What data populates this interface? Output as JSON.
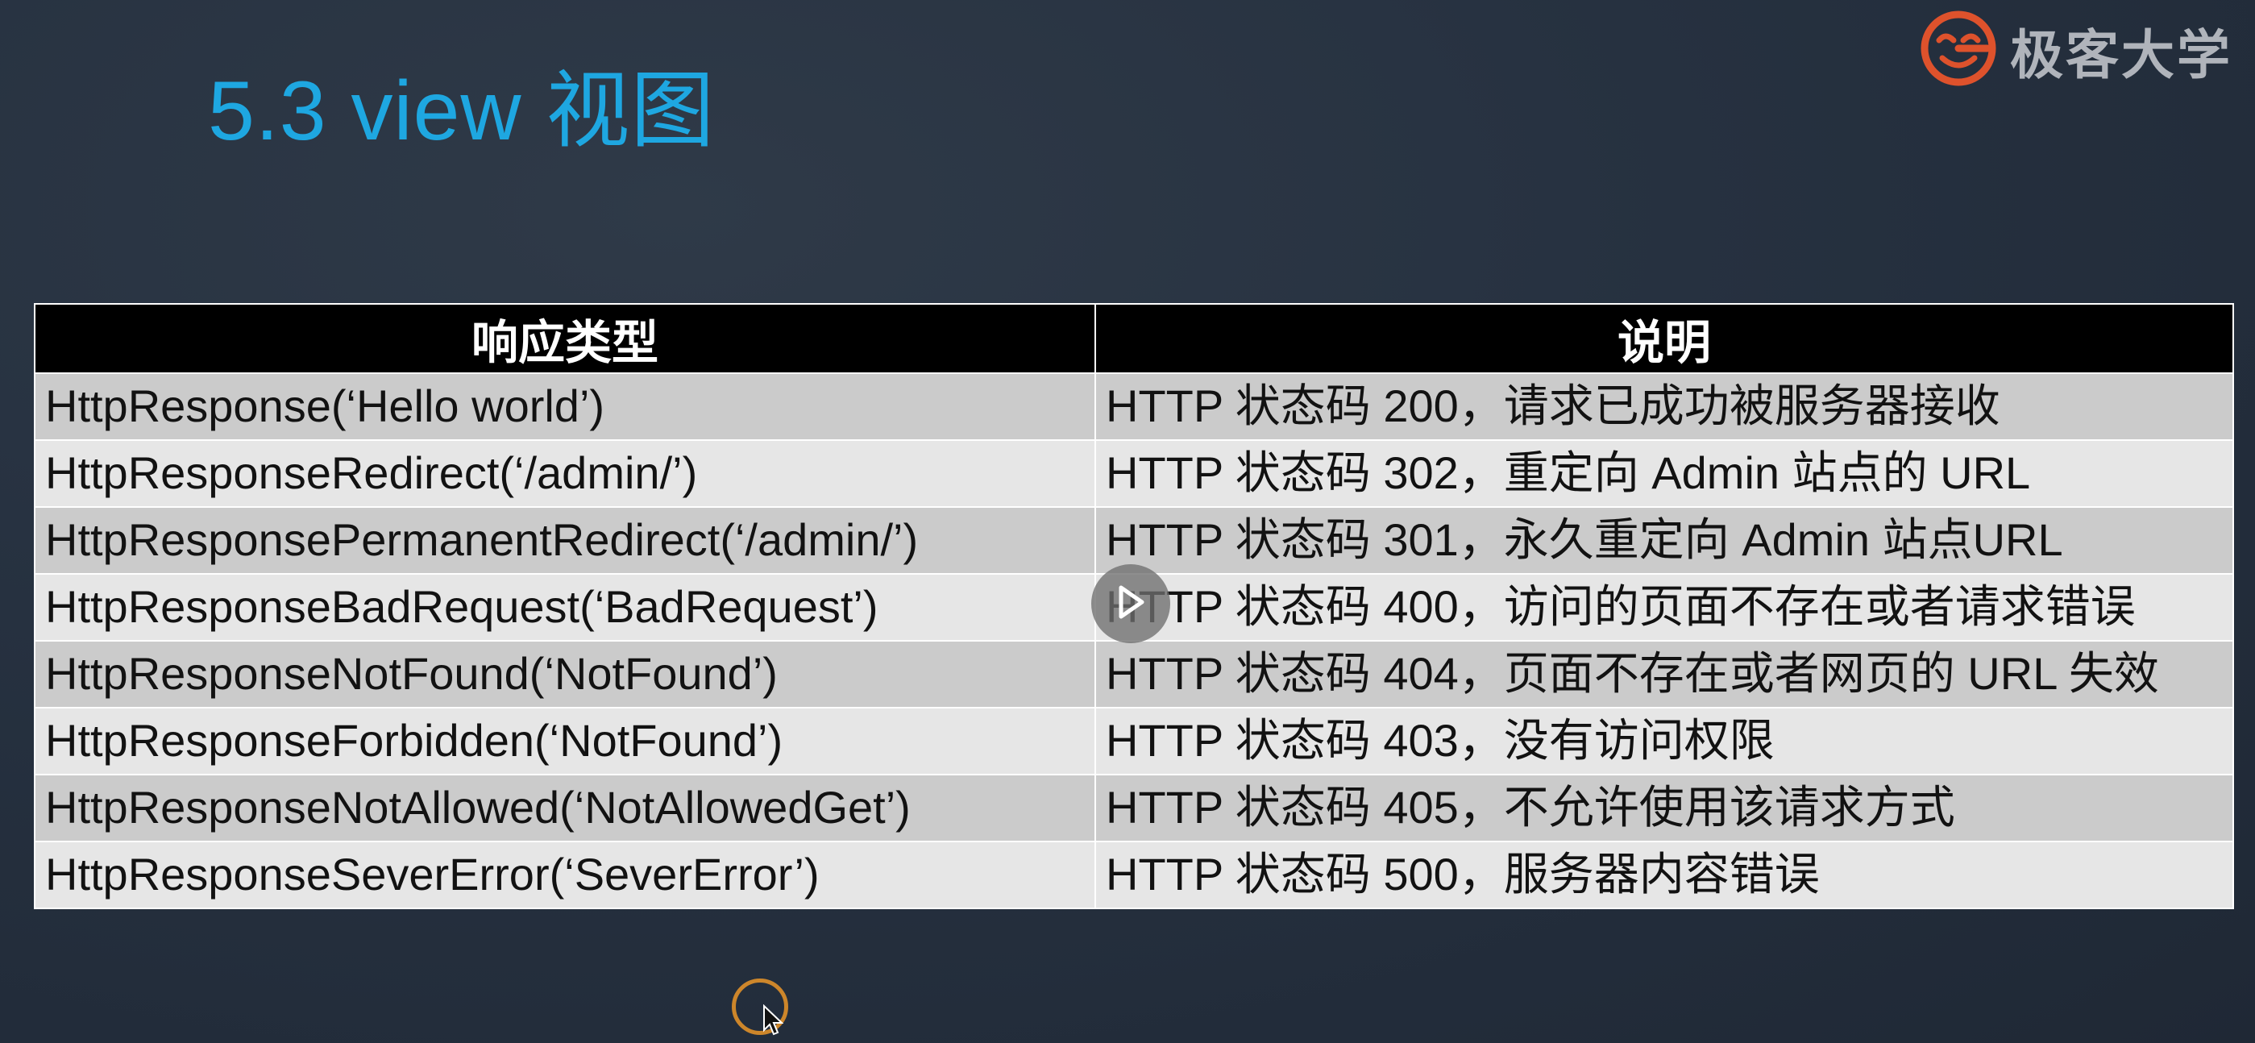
{
  "slide": {
    "title": "5.3 view 视图"
  },
  "brand": {
    "name": "极客大学",
    "logo_icon": "geek-university-logo-icon",
    "accent_color": "#e8542c"
  },
  "table": {
    "headers": [
      "响应类型",
      "说明"
    ],
    "rows": [
      {
        "type": "HttpResponse(‘Hello world’)",
        "desc": "HTTP 状态码 200，请求已成功被服务器接收"
      },
      {
        "type": "HttpResponseRedirect(‘/admin/’)",
        "desc": "HTTP 状态码 302，重定向 Admin 站点的 URL"
      },
      {
        "type": "HttpResponsePermanentRedirect(‘/admin/’)",
        "desc": "HTTP 状态码 301，永久重定向 Admin 站点URL"
      },
      {
        "type": "HttpResponseBadRequest(‘BadRequest’)",
        "desc": "HTTP 状态码 400，访问的页面不存在或者请求错误"
      },
      {
        "type": "HttpResponseNotFound(‘NotFound’)",
        "desc": "HTTP 状态码 404，页面不存在或者网页的 URL 失效"
      },
      {
        "type": "HttpResponseForbidden(‘NotFound’)",
        "desc": "HTTP 状态码 403，没有访问权限"
      },
      {
        "type": "HttpResponseNotAllowed(‘NotAllowedGet’)",
        "desc": "HTTP 状态码 405，不允许使用该请求方式"
      },
      {
        "type": "HttpResponseSeverError(‘SeverError’)",
        "desc": "HTTP 状态码 500，服务器内容错误"
      }
    ]
  },
  "overlay": {
    "play_icon": "play-icon",
    "cursor_icon": "mouse-cursor-icon"
  },
  "colors": {
    "title": "#1ea7e1",
    "header_bg": "#000000",
    "row_dark": "#cbcbcb",
    "row_light": "#e6e6e6"
  }
}
